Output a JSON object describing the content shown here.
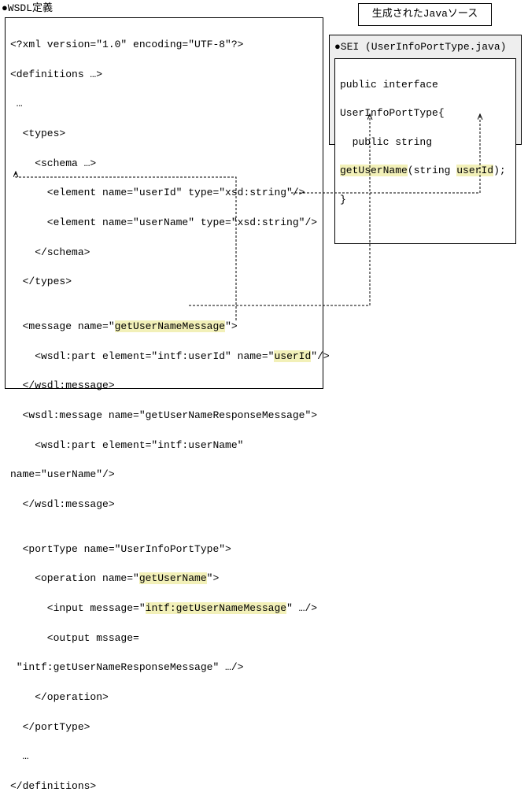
{
  "labels": {
    "wsdl_title": "●WSDL定義",
    "java_title_box": "生成されたJavaソース",
    "sei_title": "●SEI (UserInfoPortType.java)"
  },
  "wsdl": {
    "l01": "<?xml version=\"1.0\" encoding=\"UTF-8\"?>",
    "l02": "<definitions …>",
    "l03": " …",
    "l04": "  <types>",
    "l05": "    <schema …>",
    "l06": "      <element name=\"userId\" type=\"xsd:string\"/>",
    "l07": "      <element name=\"userName\" type=\"xsd:string\"/>",
    "l08": "    </schema>",
    "l09": "  </types>",
    "l10": "",
    "l11a": "  <message name=\"",
    "l11_hl": "getUserNameMessage",
    "l11b": "\">",
    "l12a": "    <wsdl:part element=\"intf:userId\" name=\"",
    "l12_hl": "userId",
    "l12b": "\"/>",
    "l13": "  </wsdl:message>",
    "l14": "  <wsdl:message name=\"getUserNameResponseMessage\">",
    "l15": "    <wsdl:part element=\"intf:userName\"",
    "l16": "name=\"userName\"/>",
    "l17": "  </wsdl:message>",
    "l18": "",
    "l19": "  <portType name=\"UserInfoPortType\">",
    "l20a": "    <operation name=\"",
    "l20_hl": "getUserName",
    "l20b": "\">",
    "l21a": "      <input message=\"",
    "l21_hl": "intf:getUserNameMessage",
    "l21b": "\" …/>",
    "l22": "      <output mssage=",
    "l23": " \"intf:getUserNameResponseMessage\" …/>",
    "l24": "    </operation>",
    "l25": "  </portType>",
    "l26": "  …",
    "l27": "</definitions>"
  },
  "java": {
    "l1": "public interface",
    "l2": "UserInfoPortType{",
    "l3": "  public string",
    "l4_hl1": "getUserName",
    "l4_mid": "(string ",
    "l4_hl2": "userId",
    "l4_end": ");",
    "l5": "}"
  }
}
